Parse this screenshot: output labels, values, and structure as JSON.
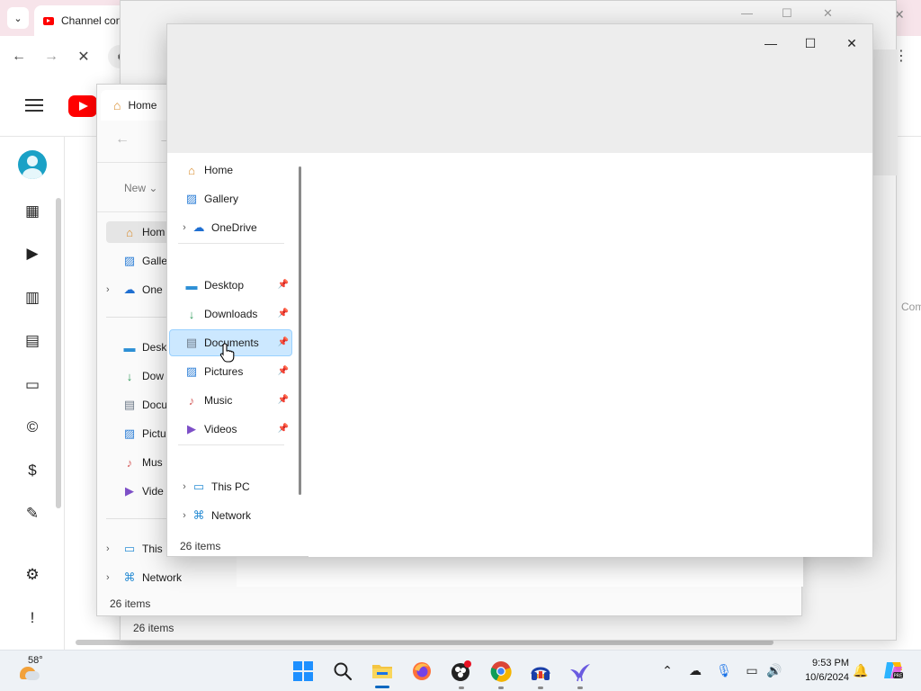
{
  "browser": {
    "tab_title": "Channel content",
    "address_text": "s",
    "right_label": "Com"
  },
  "explorer_back": {
    "status": "26 items"
  },
  "explorer_mid": {
    "tab_title": "Home",
    "new_label": "New",
    "status": "26 items",
    "nav": [
      {
        "label": "Hom",
        "icon": "home-icon",
        "chevron": ""
      },
      {
        "label": "Galle",
        "icon": "gallery-icon",
        "chevron": ""
      },
      {
        "label": "One",
        "icon": "onedrive-icon",
        "chevron": ">"
      },
      {
        "label": "Desk",
        "icon": "desktop-icon",
        "chevron": ""
      },
      {
        "label": "Dow",
        "icon": "downloads-icon",
        "chevron": ""
      },
      {
        "label": "Docu",
        "icon": "documents-icon",
        "chevron": ""
      },
      {
        "label": "Pictu",
        "icon": "pictures-icon",
        "chevron": ""
      },
      {
        "label": "Mus",
        "icon": "music-icon",
        "chevron": ""
      },
      {
        "label": "Vide",
        "icon": "videos-icon",
        "chevron": ""
      },
      {
        "label": "This",
        "icon": "this-pc-icon",
        "chevron": ">"
      },
      {
        "label": "Network",
        "icon": "network-icon",
        "chevron": ">"
      }
    ]
  },
  "explorer": {
    "status": "26 items",
    "controls": {
      "minimize": "—",
      "maximize": "☐",
      "close": "✕"
    },
    "nav": [
      {
        "label": "Home",
        "icon": "home-icon",
        "pinned": false,
        "chevron": ""
      },
      {
        "label": "Gallery",
        "icon": "gallery-icon",
        "pinned": false,
        "chevron": ""
      },
      {
        "label": "OneDrive",
        "icon": "onedrive-icon",
        "pinned": false,
        "chevron": ">"
      },
      {
        "label": "Desktop",
        "icon": "desktop-icon",
        "pinned": true,
        "chevron": ""
      },
      {
        "label": "Downloads",
        "icon": "downloads-icon",
        "pinned": true,
        "chevron": ""
      },
      {
        "label": "Documents",
        "icon": "documents-icon",
        "pinned": true,
        "chevron": "",
        "selected": true
      },
      {
        "label": "Pictures",
        "icon": "pictures-icon",
        "pinned": true,
        "chevron": ""
      },
      {
        "label": "Music",
        "icon": "music-icon",
        "pinned": true,
        "chevron": ""
      },
      {
        "label": "Videos",
        "icon": "videos-icon",
        "pinned": true,
        "chevron": ""
      },
      {
        "label": "This PC",
        "icon": "this-pc-icon",
        "pinned": false,
        "chevron": ">"
      },
      {
        "label": "Network",
        "icon": "network-icon",
        "pinned": false,
        "chevron": ">"
      }
    ]
  },
  "taskbar": {
    "temperature": "58°",
    "time": "9:53 PM",
    "date": "10/6/2024",
    "apps": [
      "start-icon",
      "search-icon",
      "file-explorer-icon",
      "firefox-icon",
      "obs-icon",
      "chrome-icon",
      "headphones-app-icon",
      "bird-app-icon"
    ]
  },
  "colors": {
    "selection": "#cce8ff",
    "accent": "#0067c0",
    "youtube_red": "#ff0000",
    "tab_strip": "#f7e4ea"
  }
}
